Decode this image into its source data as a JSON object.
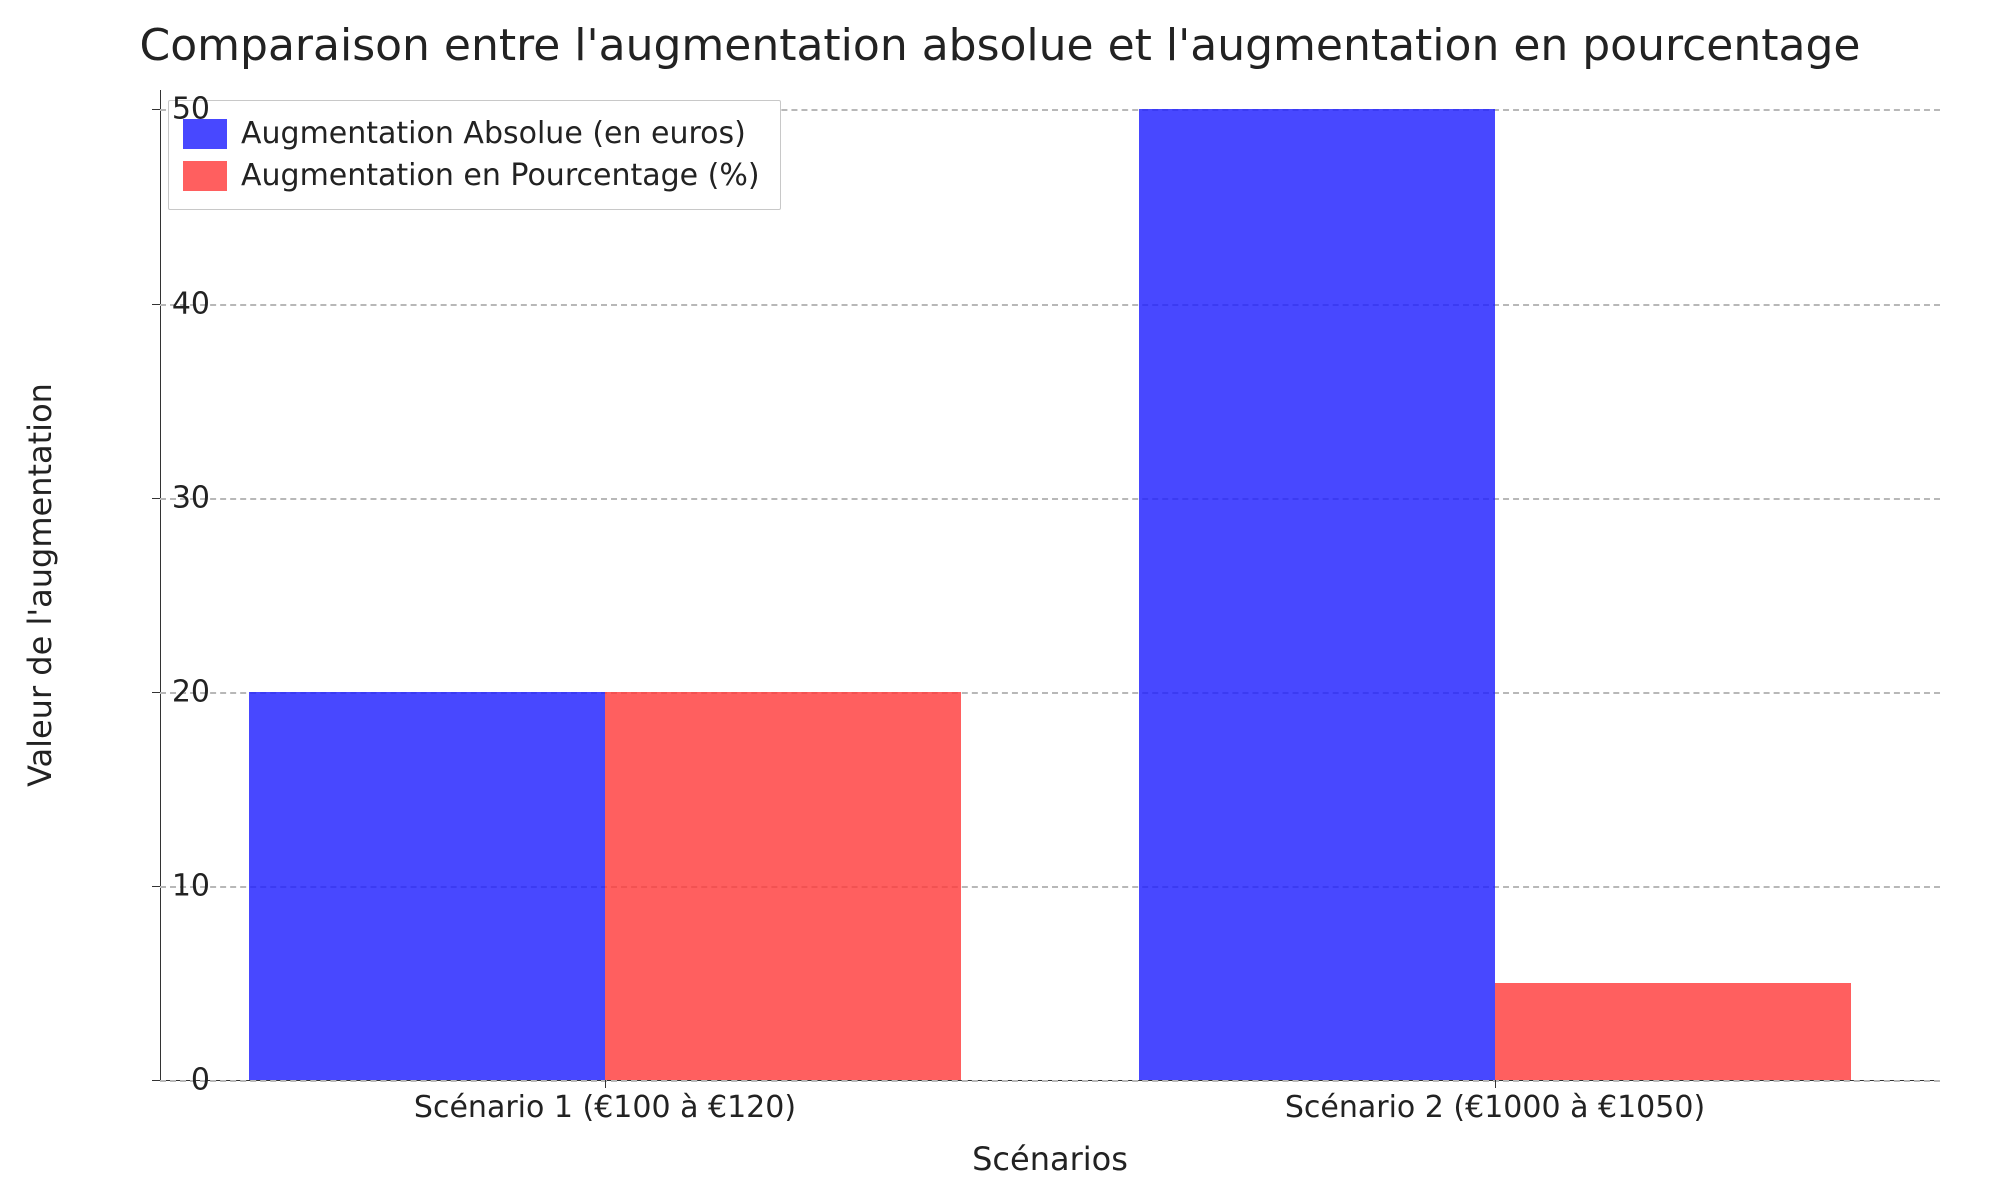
{
  "chart_data": {
    "type": "bar",
    "title": "Comparaison entre l'augmentation absolue et l'augmentation en pourcentage",
    "xlabel": "Scénarios",
    "ylabel": "Valeur de l'augmentation",
    "categories": [
      "Scénario 1 (€100 à €120)",
      "Scénario 2 (€1000 à €1050)"
    ],
    "series": [
      {
        "name": "Augmentation Absolue (en euros)",
        "color": "blue",
        "values": [
          20,
          50
        ]
      },
      {
        "name": "Augmentation en Pourcentage (%)",
        "color": "red",
        "values": [
          20,
          5
        ]
      }
    ],
    "ylim": [
      0,
      51
    ],
    "yticks": [
      0,
      10,
      20,
      30,
      40,
      50
    ],
    "grid": true,
    "legend_position": "upper left"
  }
}
